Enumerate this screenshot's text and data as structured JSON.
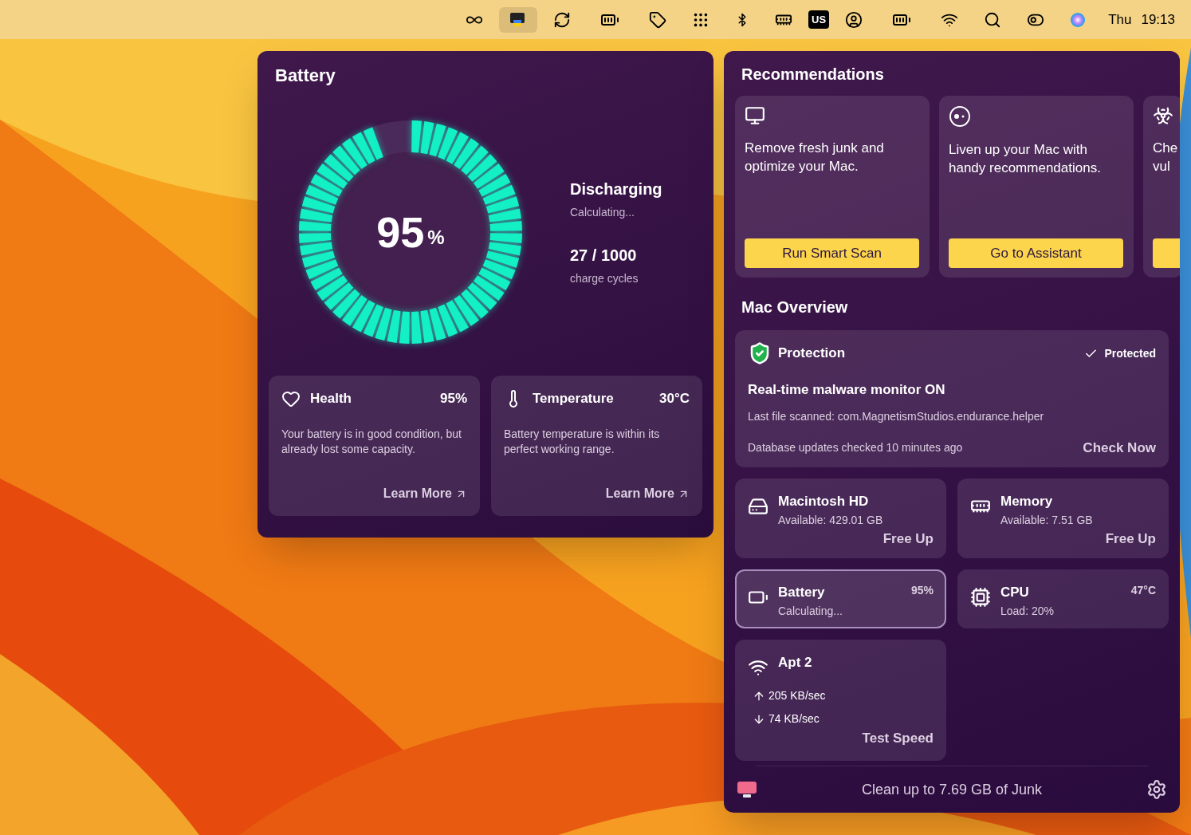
{
  "menubar": {
    "items": [
      {
        "kind": "infinity",
        "selected": false
      },
      {
        "kind": "app",
        "selected": true
      },
      {
        "kind": "refresh",
        "selected": false
      },
      {
        "kind": "battery",
        "selected": false
      },
      {
        "kind": "tag",
        "selected": false
      },
      {
        "kind": "dropbox",
        "selected": false
      },
      {
        "kind": "bluetooth",
        "selected": false
      },
      {
        "kind": "memory",
        "selected": false
      },
      {
        "kind": "text",
        "label": "US",
        "selected": false
      },
      {
        "kind": "user",
        "selected": false
      },
      {
        "kind": "battery",
        "selected": false
      },
      {
        "kind": "wifi",
        "selected": false
      },
      {
        "kind": "search",
        "selected": false
      },
      {
        "kind": "toggles",
        "selected": false
      },
      {
        "kind": "siri",
        "selected": false
      }
    ],
    "day": "Thu",
    "time": "19:13"
  },
  "battery_panel": {
    "title": "Battery",
    "level": 0.95,
    "percent": "95",
    "percent_sign": "%",
    "state": "Discharging",
    "state_detail": "Calculating...",
    "cycles": "27 / 1000",
    "cycles_label": "charge cycles",
    "cards": [
      {
        "kind": "health",
        "title": "Health",
        "value": "95%",
        "text": "Your battery is in good condition, but already lost some capacity.",
        "link": "Learn More"
      },
      {
        "kind": "temperature",
        "title": "Temperature",
        "value": "30°C",
        "text": "Battery temperature is within its perfect working range.",
        "link": "Learn More"
      }
    ]
  },
  "recommendations": {
    "title": "Recommendations",
    "cards": [
      {
        "kind": "monitor",
        "lines": [
          "Remove fresh junk and optimize your Mac."
        ],
        "button": "Run Smart Scan"
      },
      {
        "kind": "assistant",
        "lines": [
          "Liven up your Mac with handy recommendations."
        ],
        "button": "Go to Assistant"
      },
      {
        "kind": "biohazard",
        "lines": [
          "Che",
          "vul"
        ]
      }
    ]
  },
  "overview": {
    "title": "Mac Overview",
    "protection": {
      "title": "Protection",
      "status": "Protected",
      "headline": "Real-time malware monitor ON",
      "last_scanned": "Last file scanned: com.MagnetismStudios.endurance.helper",
      "updates": "Database updates checked 10 minutes ago",
      "action": "Check Now"
    },
    "tiles": [
      {
        "kind": "disk",
        "title": "Macintosh HD",
        "detail": "Available: 429.01 GB",
        "action": "Free Up",
        "selected": false
      },
      {
        "kind": "memory",
        "title": "Memory",
        "detail": "Available: 7.51 GB",
        "action": "Free Up",
        "selected": false
      },
      {
        "kind": "battery",
        "title": "Battery",
        "detail": "Calculating...",
        "value": "95%",
        "selected": true
      },
      {
        "kind": "cpu",
        "title": "CPU",
        "detail": "Load: 20%",
        "value": "47°C",
        "selected": false
      },
      {
        "kind": "network",
        "title": "Apt 2",
        "upload": "205 KB/sec",
        "download": "74 KB/sec",
        "action": "Test Speed",
        "selected": false
      }
    ]
  },
  "footer": {
    "text": "Clean up to 7.69 GB of Junk"
  }
}
